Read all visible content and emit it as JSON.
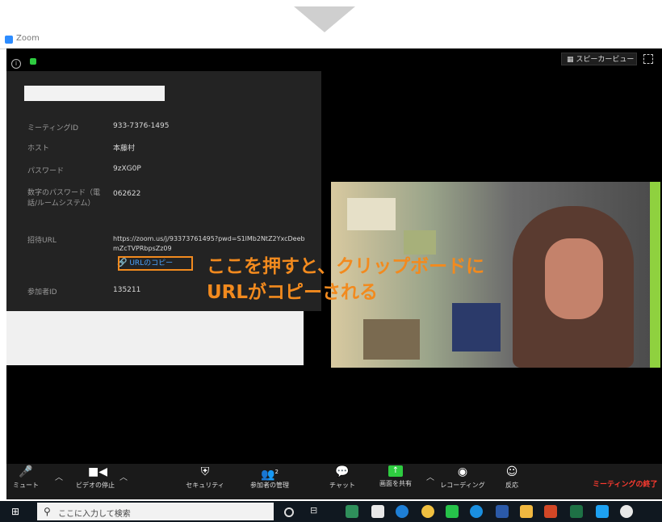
{
  "window": {
    "title": "Zoom"
  },
  "header": {
    "view_label": "スピーカービュー"
  },
  "meeting_info": {
    "rows": [
      {
        "label": "ミーティングID",
        "value": "933-7376-1495"
      },
      {
        "label": "ホスト",
        "value": "本藤村"
      },
      {
        "label": "パスワード",
        "value": "9zXG0P"
      },
      {
        "label": "数字のパスワード（電話/ルームシステム）",
        "value": "062622"
      },
      {
        "label": "招待URL",
        "value": "https://zoom.us/j/93373761495?pwd=S1lMb2NtZ2YxcDeebmZcTVPRbpsZz09"
      },
      {
        "label": "参加者ID",
        "value": "135211"
      }
    ],
    "copy_url_label": "URLのコピー"
  },
  "callout": {
    "line1": "ここを押すと、クリップボードに",
    "line2": "URLがコピーされる",
    "color": "#f28a1e"
  },
  "toolbar": {
    "mute": "ミュート",
    "stop_video": "ビデオの停止",
    "security": "セキュリティ",
    "participants": "参加者の管理",
    "participants_count": "2",
    "chat": "チャット",
    "share": "画面を共有",
    "record": "レコーディング",
    "reactions": "反応",
    "end": "ミーティングの終了"
  },
  "taskbar": {
    "search_placeholder": "ここに入力して検索"
  }
}
